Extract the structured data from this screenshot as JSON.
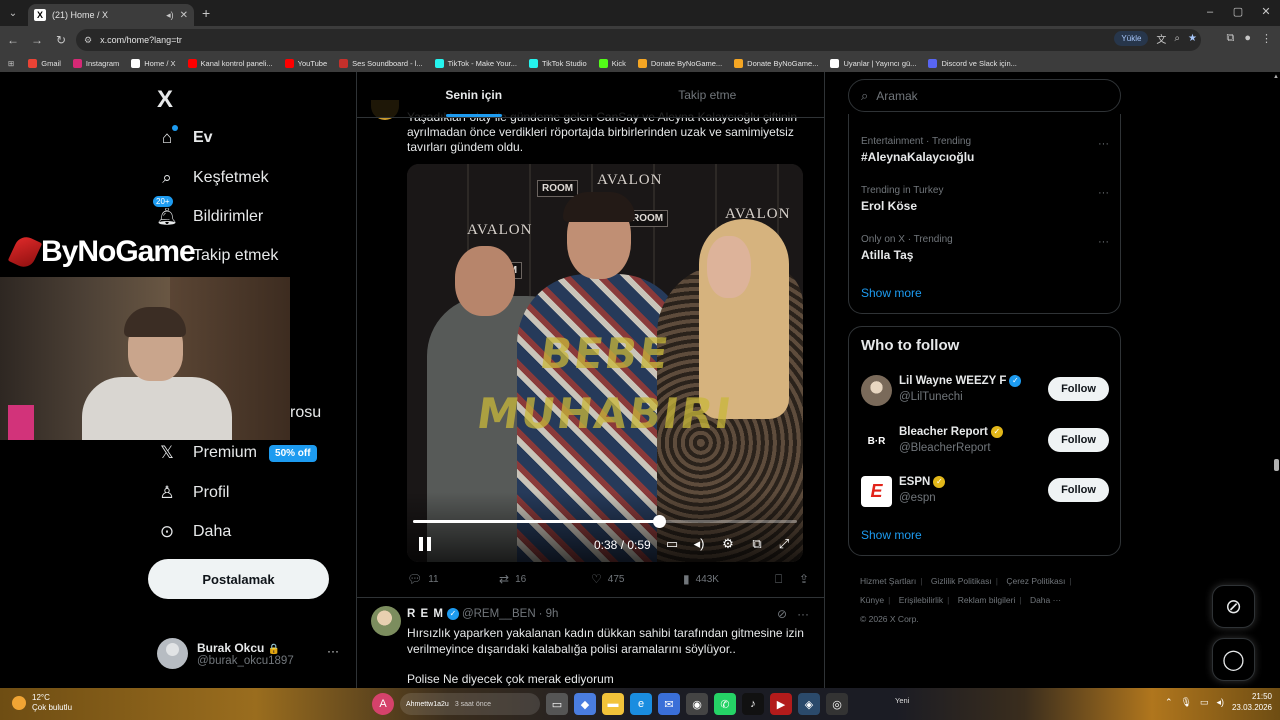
{
  "browser": {
    "tab_title": "(21) Home / X",
    "url": "x.com/home?lang=tr",
    "upload_label": "Yükle",
    "bookmarks": [
      {
        "label": "Gmail",
        "color": "#ea4335"
      },
      {
        "label": "Instagram",
        "color": "#d62976"
      },
      {
        "label": "Home / X",
        "color": "#ffffff"
      },
      {
        "label": "Kanal kontrol paneli...",
        "color": "#ff0000"
      },
      {
        "label": "YouTube",
        "color": "#ff0000"
      },
      {
        "label": "Ses Soundboard - l...",
        "color": "#c4302b"
      },
      {
        "label": "TikTok - Make Your...",
        "color": "#25f4ee"
      },
      {
        "label": "TikTok Studio",
        "color": "#25f4ee"
      },
      {
        "label": "Kick",
        "color": "#53fc18"
      },
      {
        "label": "Donate ByNoGame...",
        "color": "#f5a623"
      },
      {
        "label": "Donate ByNoGame...",
        "color": "#f5a623"
      },
      {
        "label": "Uyanlar | Yayıncı gü...",
        "color": "#ffffff"
      },
      {
        "label": "Discord ve Slack için...",
        "color": "#5865f2"
      }
    ]
  },
  "sidebar": {
    "logo": "X",
    "items": [
      {
        "label": "Ev",
        "icon": "home-icon"
      },
      {
        "label": "Keşfetmek",
        "icon": "search-icon"
      },
      {
        "label": "Bildirimler",
        "icon": "bell-icon",
        "badge": "20+"
      },
      {
        "label": "Takip etmek",
        "icon": "people-icon"
      },
      {
        "label": "Premium",
        "icon": "x-icon",
        "tag": "50% off"
      },
      {
        "label": "Profil",
        "icon": "person-icon"
      },
      {
        "label": "Daha",
        "icon": "more-circle-icon"
      }
    ],
    "partial_item": "rosu",
    "post_button": "Postalamak",
    "user": {
      "name": "Burak Okcu",
      "handle": "@burak_okcu1897",
      "lock": "🔒",
      "more": "···"
    }
  },
  "overlay": {
    "brand": "ByNoGame"
  },
  "main": {
    "tabs": [
      {
        "label": "Senin için",
        "active": true
      },
      {
        "label": "Takip etme",
        "active": false
      }
    ],
    "tweet1": {
      "text_line1": "Yaşadıkları olay ile gündeme gelen CanSay ve Aleyna Kalaycıoğlu çiftinin",
      "text_line2": "ayrılmadan önce verdikleri röportajda birbirlerinden uzak ve samimiyetsiz",
      "text_line3": "tavırları gündem oldu.",
      "video": {
        "watermark_top": "BEBE",
        "watermark_bottom": "MUHABIRI",
        "brand_a": "AVALON",
        "brand_b": "ROOM",
        "current_time": "0:38",
        "duration": "0:59",
        "time_display": "0:38 / 0:59",
        "progress": 0.64
      },
      "stats": {
        "replies": "11",
        "reposts": "16",
        "likes": "475",
        "views": "443K"
      }
    },
    "tweet2": {
      "name": "R E M",
      "handle": "@REM__BEN",
      "time": "· 9h",
      "line1": "Hırsızlık yaparken yakalanan kadın dükkan sahibi tarafından gitmesine izin",
      "line2": "verilmeyince dışarıdaki kalabalığa polisi aramalarını söylüyor..",
      "line3": "Polise Ne diyecek çok merak ediyorum"
    }
  },
  "right": {
    "search_placeholder": "Aramak",
    "trends": [
      {
        "meta": "Entertainment · Trending",
        "name": "#AleynaKalaycıoğlu"
      },
      {
        "meta": "Trending in Turkey",
        "name": "Erol Köse"
      },
      {
        "meta": "Only on X · Trending",
        "name": "Atilla Taş"
      }
    ],
    "show_more": "Show more",
    "who_to_follow": {
      "title": "Who to follow",
      "accounts": [
        {
          "name": "Lil Wayne WEEZY F",
          "handle": "@LilTunechi",
          "badge": "blue",
          "avatar_color": "#8a7a6a"
        },
        {
          "name": "Bleacher Report",
          "handle": "@BleacherReport",
          "badge": "gold",
          "avatar_color": "#000000",
          "avatar_text": "B·R"
        },
        {
          "name": "ESPN",
          "handle": "@espn",
          "badge": "gold",
          "avatar_color": "#ffffff",
          "avatar_text": "E"
        }
      ],
      "follow_label": "Follow",
      "show_more": "Show more"
    },
    "footer": {
      "links": [
        "Hizmet Şartları",
        "Gizlilik Politikası",
        "Çerez Politikası",
        "Künye",
        "Erişilebilirlik",
        "Reklam bilgileri",
        "Daha ···"
      ],
      "copyright": "© 2026 X Corp."
    }
  },
  "taskbar": {
    "temp": "12°C",
    "weather": "Çok bulutlu",
    "search_text": "Ahmettw1a2u",
    "search_sub": "3 saat önce",
    "notif_text": "Yeni",
    "time": "21:50",
    "date": "23.03.2026"
  },
  "colors": {
    "accent": "#1d9bf0",
    "background": "#000000",
    "border": "#2f3336",
    "muted": "#71767b"
  }
}
